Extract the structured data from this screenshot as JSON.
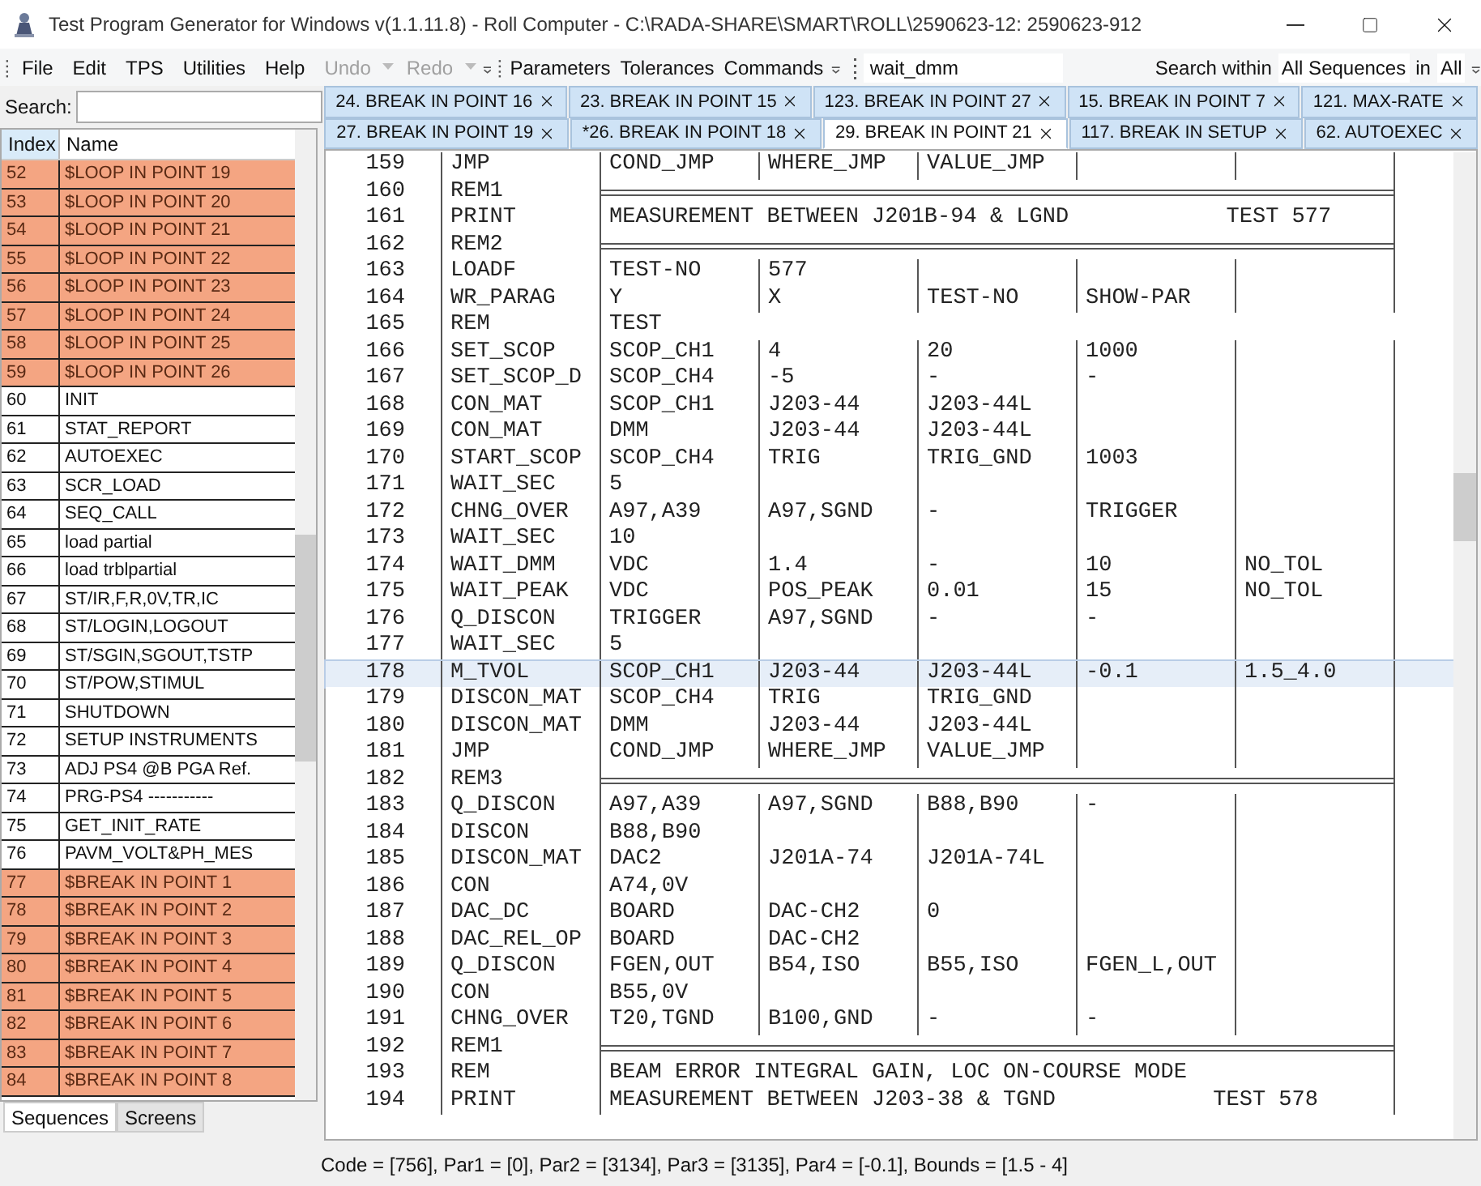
{
  "window": {
    "title": "Test Program Generator for Windows v(1.1.11.8) - Roll Computer - C:\\RADA-SHARE\\SMART\\ROLL\\2590623-12: 2590623-912"
  },
  "menu": [
    {
      "label": "File",
      "disabled": false
    },
    {
      "label": "Edit",
      "disabled": false
    },
    {
      "label": "TPS",
      "disabled": false
    },
    {
      "label": "Utilities",
      "disabled": false
    },
    {
      "label": "Help",
      "disabled": false
    },
    {
      "label": "Undo",
      "disabled": true
    },
    {
      "label": "Redo",
      "disabled": true
    }
  ],
  "commands": [
    "Parameters",
    "Tolerances",
    "Commands"
  ],
  "search_toolbar": {
    "value": "wait_dmm",
    "within_label": "Search within",
    "scope": "All Sequences",
    "in_label": "in",
    "area": "All"
  },
  "sidebar": {
    "search_label": "Search:",
    "columns": [
      "Index",
      "Name"
    ],
    "rows": [
      {
        "index": "52",
        "name": "$LOOP IN POINT 19",
        "highlighted": true
      },
      {
        "index": "53",
        "name": "$LOOP IN POINT 20",
        "highlighted": true
      },
      {
        "index": "54",
        "name": "$LOOP IN POINT 21",
        "highlighted": true
      },
      {
        "index": "55",
        "name": "$LOOP IN POINT 22",
        "highlighted": true
      },
      {
        "index": "56",
        "name": "$LOOP IN POINT 23",
        "highlighted": true
      },
      {
        "index": "57",
        "name": "$LOOP IN POINT 24",
        "highlighted": true
      },
      {
        "index": "58",
        "name": "$LOOP IN POINT 25",
        "highlighted": true
      },
      {
        "index": "59",
        "name": "$LOOP IN POINT 26",
        "highlighted": true
      },
      {
        "index": "60",
        "name": "INIT",
        "highlighted": false
      },
      {
        "index": "61",
        "name": "STAT_REPORT",
        "highlighted": false
      },
      {
        "index": "62",
        "name": "AUTOEXEC",
        "highlighted": false
      },
      {
        "index": "63",
        "name": "SCR_LOAD",
        "highlighted": false
      },
      {
        "index": "64",
        "name": "SEQ_CALL",
        "highlighted": false
      },
      {
        "index": "65",
        "name": "load partial",
        "highlighted": false
      },
      {
        "index": "66",
        "name": "load trblpartial",
        "highlighted": false
      },
      {
        "index": "67",
        "name": "ST/IR,F,R,0V,TR,IC",
        "highlighted": false
      },
      {
        "index": "68",
        "name": "ST/LOGIN,LOGOUT",
        "highlighted": false
      },
      {
        "index": "69",
        "name": "ST/SGIN,SGOUT,TSTP",
        "highlighted": false
      },
      {
        "index": "70",
        "name": "ST/POW,STIMUL",
        "highlighted": false
      },
      {
        "index": "71",
        "name": "SHUTDOWN",
        "highlighted": false
      },
      {
        "index": "72",
        "name": "SETUP INSTRUMENTS",
        "highlighted": false
      },
      {
        "index": "73",
        "name": "ADJ PS4 @B PGA Ref.",
        "highlighted": false
      },
      {
        "index": "74",
        "name": "PRG-PS4 -----------",
        "highlighted": false
      },
      {
        "index": "75",
        "name": "GET_INIT_RATE",
        "highlighted": false
      },
      {
        "index": "76",
        "name": "PAVM_VOLT&PH_MES",
        "highlighted": false
      },
      {
        "index": "77",
        "name": "$BREAK IN POINT 1",
        "highlighted": true
      },
      {
        "index": "78",
        "name": "$BREAK IN POINT 2",
        "highlighted": true
      },
      {
        "index": "79",
        "name": "$BREAK IN POINT 3",
        "highlighted": true
      },
      {
        "index": "80",
        "name": "$BREAK IN POINT 4",
        "highlighted": true
      },
      {
        "index": "81",
        "name": "$BREAK IN POINT 5",
        "highlighted": true
      },
      {
        "index": "82",
        "name": "$BREAK IN POINT 6",
        "highlighted": true
      },
      {
        "index": "83",
        "name": "$BREAK IN POINT 7",
        "highlighted": true
      },
      {
        "index": "84",
        "name": "$BREAK IN POINT 8",
        "highlighted": true
      }
    ],
    "tabs": [
      {
        "label": "Sequences",
        "selected": true
      },
      {
        "label": "Screens",
        "selected": false
      }
    ]
  },
  "tab_rows": [
    [
      {
        "label": "24. BREAK IN POINT 16",
        "selected": false
      },
      {
        "label": "23. BREAK IN POINT 15",
        "selected": false
      },
      {
        "label": "123. BREAK IN POINT 27",
        "selected": false
      },
      {
        "label": "15. BREAK IN POINT 7",
        "selected": false
      },
      {
        "label": "121. MAX-RATE",
        "selected": false
      }
    ],
    [
      {
        "label": "27. BREAK IN POINT 19",
        "selected": false
      },
      {
        "label": "*26. BREAK IN POINT 18",
        "selected": false
      },
      {
        "label": "29. BREAK IN POINT 21",
        "selected": true
      },
      {
        "label": "117. BREAK IN SETUP",
        "selected": false
      },
      {
        "label": "62. AUTOEXEC",
        "selected": false
      }
    ]
  ],
  "code": {
    "rows": [
      {
        "line": "159",
        "command": "JMP",
        "kind": "grid",
        "cells": [
          "COND_JMP",
          "WHERE_JMP",
          "VALUE_JMP"
        ],
        "selected": false
      },
      {
        "line": "160",
        "command": "REM1",
        "kind": "rule",
        "selected": false
      },
      {
        "line": "161",
        "command": "PRINT",
        "kind": "text",
        "text": "MEASUREMENT BETWEEN J201B-94 & LGND            TEST 577",
        "selected": false
      },
      {
        "line": "162",
        "command": "REM2",
        "kind": "rule",
        "selected": false
      },
      {
        "line": "163",
        "command": "LOADF",
        "kind": "grid",
        "cells": [
          "TEST-NO",
          "577"
        ],
        "selected": false
      },
      {
        "line": "164",
        "command": "WR_PARAG",
        "kind": "grid",
        "cells": [
          "Y",
          "X",
          "TEST-NO",
          "SHOW-PAR"
        ],
        "selected": false
      },
      {
        "line": "165",
        "command": "REM",
        "kind": "plain",
        "cells": [
          "TEST"
        ],
        "selected": false
      },
      {
        "line": "166",
        "command": "SET_SCOP",
        "kind": "grid",
        "cells": [
          "SCOP_CH1",
          "4",
          "20",
          "1000"
        ],
        "selected": false
      },
      {
        "line": "167",
        "command": "SET_SCOP_D",
        "kind": "grid",
        "cells": [
          "SCOP_CH4",
          "-5",
          "-",
          "-"
        ],
        "selected": false
      },
      {
        "line": "168",
        "command": "CON_MAT",
        "kind": "grid",
        "cells": [
          "SCOP_CH1",
          "J203-44",
          "J203-44L"
        ],
        "selected": false
      },
      {
        "line": "169",
        "command": "CON_MAT",
        "kind": "grid",
        "cells": [
          "DMM",
          "J203-44",
          "J203-44L"
        ],
        "selected": false
      },
      {
        "line": "170",
        "command": "START_SCOP",
        "kind": "grid",
        "cells": [
          "SCOP_CH4",
          "TRIG",
          "TRIG_GND",
          "1003"
        ],
        "selected": false
      },
      {
        "line": "171",
        "command": "WAIT_SEC",
        "kind": "grid",
        "cells": [
          "5"
        ],
        "selected": false
      },
      {
        "line": "172",
        "command": "CHNG_OVER",
        "kind": "grid",
        "cells": [
          "A97,A39",
          "A97,SGND",
          "-",
          "TRIGGER"
        ],
        "selected": false
      },
      {
        "line": "173",
        "command": "WAIT_SEC",
        "kind": "grid",
        "cells": [
          "10"
        ],
        "selected": false
      },
      {
        "line": "174",
        "command": "WAIT_DMM",
        "kind": "grid",
        "cells": [
          "VDC",
          "1.4",
          "-",
          "10",
          "NO_TOL"
        ],
        "selected": false
      },
      {
        "line": "175",
        "command": "WAIT_PEAK",
        "kind": "grid",
        "cells": [
          "VDC",
          "POS_PEAK",
          "0.01",
          "15",
          "NO_TOL"
        ],
        "selected": false
      },
      {
        "line": "176",
        "command": "Q_DISCON",
        "kind": "grid",
        "cells": [
          "TRIGGER",
          "A97,SGND",
          "-",
          "-"
        ],
        "selected": false
      },
      {
        "line": "177",
        "command": "WAIT_SEC",
        "kind": "grid",
        "cells": [
          "5"
        ],
        "selected": false
      },
      {
        "line": "178",
        "command": "M_TVOL",
        "kind": "grid",
        "cells": [
          "SCOP_CH1",
          "J203-44",
          "J203-44L",
          "-0.1",
          "1.5_4.0"
        ],
        "selected": true
      },
      {
        "line": "179",
        "command": "DISCON_MAT",
        "kind": "grid",
        "cells": [
          "SCOP_CH4",
          "TRIG",
          "TRIG_GND"
        ],
        "selected": false
      },
      {
        "line": "180",
        "command": "DISCON_MAT",
        "kind": "grid",
        "cells": [
          "DMM",
          "J203-44",
          "J203-44L"
        ],
        "selected": false
      },
      {
        "line": "181",
        "command": "JMP",
        "kind": "grid",
        "cells": [
          "COND_JMP",
          "WHERE_JMP",
          "VALUE_JMP"
        ],
        "selected": false
      },
      {
        "line": "182",
        "command": "REM3",
        "kind": "rule",
        "selected": false
      },
      {
        "line": "183",
        "command": "Q_DISCON",
        "kind": "grid",
        "cells": [
          "A97,A39",
          "A97,SGND",
          "B88,B90",
          "-"
        ],
        "selected": false
      },
      {
        "line": "184",
        "command": "DISCON",
        "kind": "grid",
        "cells": [
          "B88,B90"
        ],
        "selected": false
      },
      {
        "line": "185",
        "command": "DISCON_MAT",
        "kind": "grid",
        "cells": [
          "DAC2",
          "J201A-74",
          "J201A-74L"
        ],
        "selected": false
      },
      {
        "line": "186",
        "command": "CON",
        "kind": "grid",
        "cells": [
          "A74,0V"
        ],
        "selected": false
      },
      {
        "line": "187",
        "command": "DAC_DC",
        "kind": "grid",
        "cells": [
          "BOARD",
          "DAC-CH2",
          "0"
        ],
        "selected": false
      },
      {
        "line": "188",
        "command": "DAC_REL_OP",
        "kind": "grid",
        "cells": [
          "BOARD",
          "DAC-CH2"
        ],
        "selected": false
      },
      {
        "line": "189",
        "command": "Q_DISCON",
        "kind": "grid",
        "cells": [
          "FGEN,OUT",
          "B54,ISO",
          "B55,ISO",
          "FGEN_L,OUT"
        ],
        "selected": false
      },
      {
        "line": "190",
        "command": "CON",
        "kind": "grid",
        "cells": [
          "B55,0V"
        ],
        "selected": false
      },
      {
        "line": "191",
        "command": "CHNG_OVER",
        "kind": "grid",
        "cells": [
          "T20,TGND",
          "B100,GND",
          "-",
          "-"
        ],
        "selected": false
      },
      {
        "line": "192",
        "command": "REM1",
        "kind": "rule",
        "selected": false
      },
      {
        "line": "193",
        "command": "REM",
        "kind": "text",
        "text": "BEAM ERROR INTEGRAL GAIN, LOC ON-COURSE MODE",
        "selected": false
      },
      {
        "line": "194",
        "command": "PRINT",
        "kind": "text",
        "text": "MEASUREMENT BETWEEN J203-38 & TGND            TEST 578",
        "selected": false
      }
    ]
  },
  "status_bar": "Code = [756], Par1 = [0], Par2 = [3134], Par3 = [3135], Par4 = [-0.1], Bounds = [1.5 - 4]"
}
